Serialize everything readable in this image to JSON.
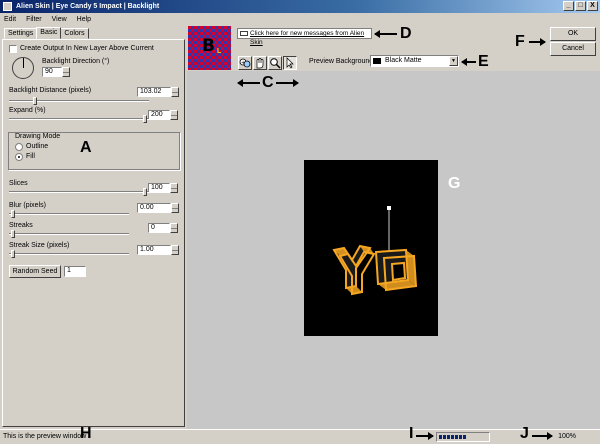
{
  "window": {
    "title": "Alien Skin | Eye Candy 5 Impact | Backlight",
    "controls": [
      "_",
      "□",
      "X"
    ]
  },
  "menu": [
    "Edit",
    "Filter",
    "View",
    "Help"
  ],
  "tabs": [
    "Settings",
    "Basic",
    "Colors"
  ],
  "basic": {
    "create_output_label": "Create Output In New Layer Above Current",
    "direction_label": "Backlight Direction (°)",
    "direction_value": "90",
    "distance_label": "Backlight Distance (pixels)",
    "distance_value": "103.02",
    "expand_label": "Expand (%)",
    "expand_value": "200",
    "drawing_mode_label": "Drawing Mode",
    "mode_outline": "Outline",
    "mode_fill": "Fill",
    "slices_label": "Slices",
    "slices_value": "100",
    "blur_label": "Blur (pixels)",
    "blur_value": "0.00",
    "streaks_label": "Streaks",
    "streaks_value": "0",
    "streak_size_label": "Streak Size (pixels)",
    "streak_size_value": "1.00",
    "random_seed_label": "Random Seed",
    "random_seed_value": "1"
  },
  "top": {
    "thumb_letter": "B",
    "thumb_sub": "L",
    "message_link": "Click here for new messages from Alien Skin",
    "preview_bg_label": "Preview Background:",
    "preview_bg_value": "Black Matte",
    "ok_label": "OK",
    "cancel_label": "Cancel"
  },
  "tools": [
    "zoom-plus-minus-icon",
    "hand-icon",
    "magnifier-icon",
    "arrow-pointer-icon"
  ],
  "status": {
    "text": "This is the preview window",
    "zoom": "100%",
    "progress": 0.55
  },
  "annotations": {
    "A": "A",
    "C": "C",
    "D": "D",
    "E": "E",
    "F": "F",
    "G": "G",
    "H": "H",
    "I": "I",
    "J": "J"
  },
  "colors": {
    "title_gradient_start": "#0a246a",
    "preview_bg": "#000000",
    "art_color": "#f5a623"
  }
}
